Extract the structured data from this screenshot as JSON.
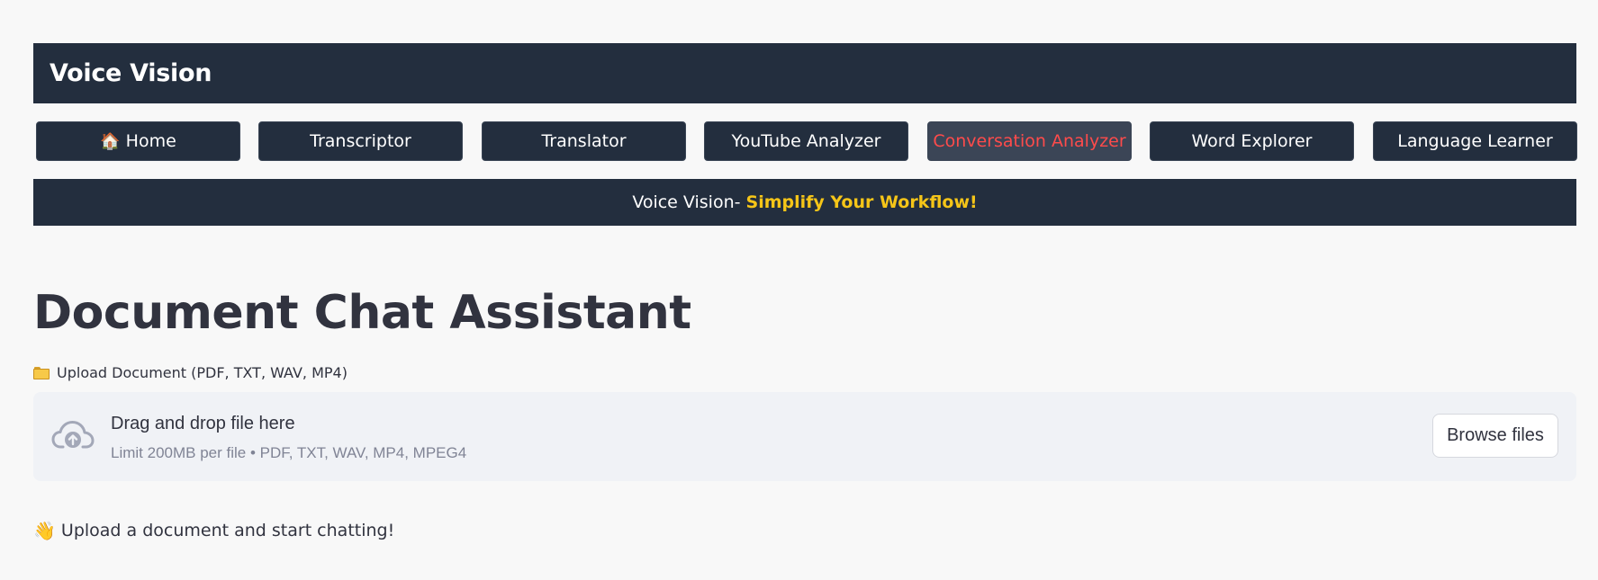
{
  "header": {
    "title": "Voice Vision"
  },
  "nav": {
    "items": [
      {
        "label": "Home",
        "icon": "house-icon",
        "glyph": "🏠"
      },
      {
        "label": "Transcriptor"
      },
      {
        "label": "Translator"
      },
      {
        "label": "YouTube Analyzer"
      },
      {
        "label": "Conversation Analyzer",
        "active": true
      },
      {
        "label": "Word Explorer"
      },
      {
        "label": "Language Learner"
      }
    ]
  },
  "banner": {
    "prefix": "Voice Vision- ",
    "highlight": "Simplify Your Workflow!"
  },
  "main": {
    "title": "Document Chat Assistant",
    "upload_label": "Upload Document (PDF, TXT, WAV, MP4)",
    "dropzone": {
      "drag_text": "Drag and drop file here",
      "limit_text": "Limit 200MB per file • PDF, TXT, WAV, MP4, MPEG4",
      "browse_label": "Browse files"
    },
    "hint": "Upload a document and start chatting!",
    "hint_glyph": "👋"
  },
  "colors": {
    "background": "#f8f8f8",
    "navy": "#232e3e",
    "active_nav": "#3b4556",
    "active_text": "#ff4b4b",
    "highlight": "#f5c518",
    "dropzone_bg": "#f0f2f6"
  }
}
